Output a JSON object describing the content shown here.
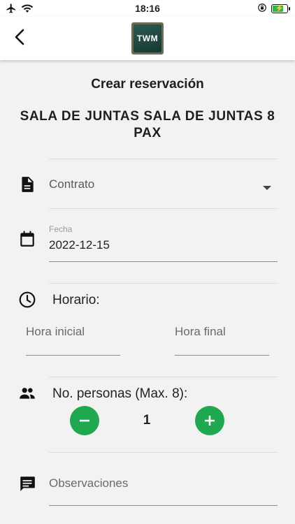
{
  "status_bar": {
    "time": "18:16"
  },
  "colors": {
    "accent": "#1fa84f",
    "battery": "#37b24d"
  },
  "screen": {
    "title": "Crear reservación",
    "room_name": "SALA DE JUNTAS SALA DE JUNTAS  8 PAX"
  },
  "form": {
    "contract": {
      "placeholder": "Contrato"
    },
    "date": {
      "label": "Fecha",
      "value": "2022-12-15"
    },
    "schedule": {
      "label": "Horario:",
      "start_placeholder": "Hora inicial",
      "end_placeholder": "Hora final"
    },
    "people": {
      "label": "No. personas (Max. 8):",
      "count": "1"
    },
    "notes": {
      "placeholder": "Observaciones"
    }
  },
  "logo": {
    "text": "TWM"
  }
}
